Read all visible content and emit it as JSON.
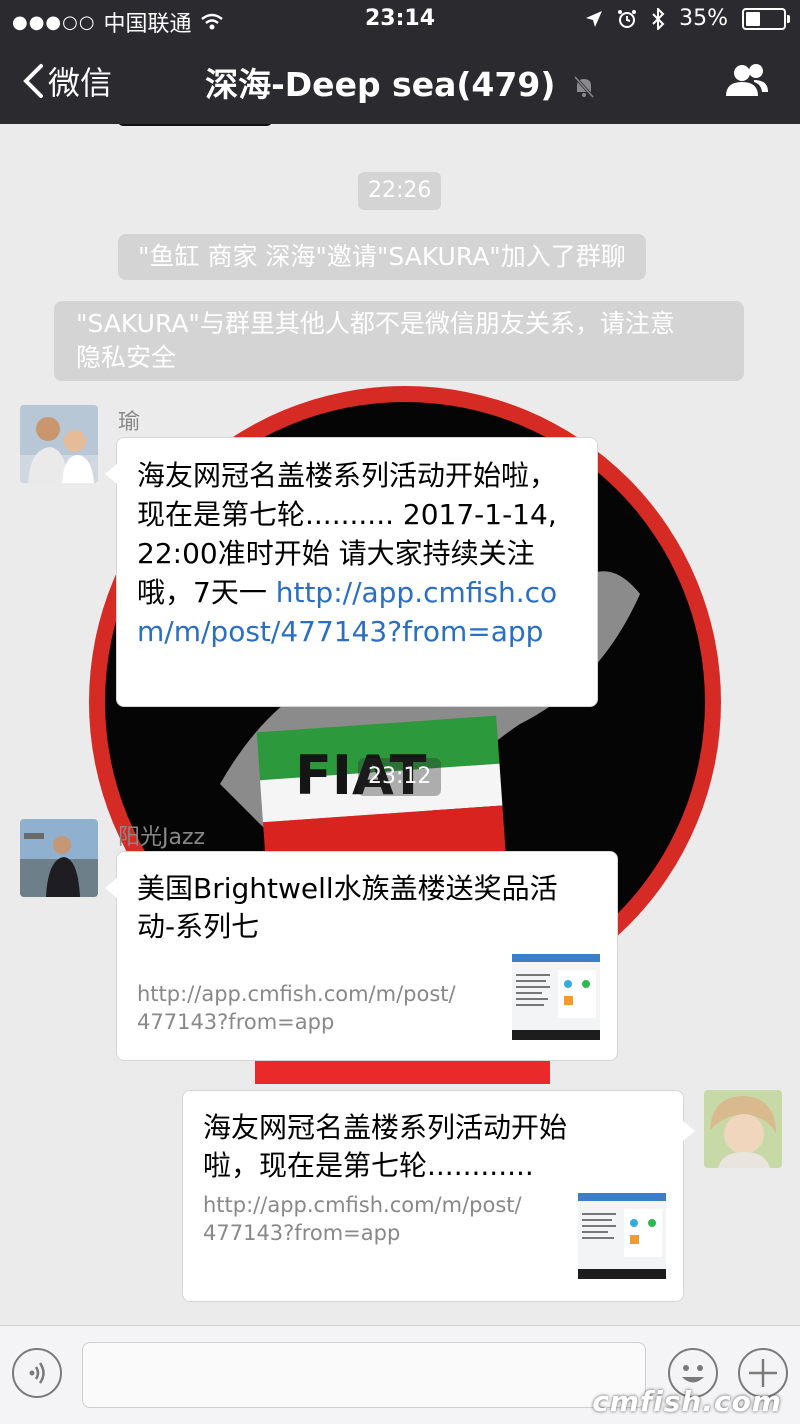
{
  "status_bar": {
    "signal": "●●●○○",
    "carrier": "中国联通",
    "time": "23:14",
    "battery": "35%",
    "battery_level": 0.35
  },
  "nav": {
    "back_label": "微信",
    "title": "深海-Deep sea(479)"
  },
  "chat": {
    "time_chip_1": "22:26",
    "system_1": "\"鱼缸 商家 深海\"邀请\"SAKURA\"加入了群聊",
    "system_2_line1": "\"SAKURA\"与群里其他人都不是微信朋友关系，请注意",
    "system_2_line2": "隐私安全",
    "msg1": {
      "sender": "瑜",
      "text": "海友网冠名盖楼系列活动开始啦，现在是第七轮.......... 2017-1-14, 22:00准时开始 请大家持续关注哦，7天一 ",
      "link": "http://app.cmfish.com/m/post/477143?from=app"
    },
    "time_chip_2": "23:12",
    "msg2": {
      "sender": "阳光Jazz",
      "title_line1": "美国Brightwell水族盖楼送奖品活",
      "title_line2": "动-系列七",
      "url_line1": "http://app.cmfish.com/m/post/",
      "url_line2": "477143?from=app"
    },
    "msg3": {
      "title_line1": "海友网冠名盖楼系列活动开始",
      "title_line2": "啦，现在是第七轮............",
      "url_line1": "http://app.cmfish.com/m/post/",
      "url_line2": "477143?from=app"
    },
    "wallpaper_text": "FIAT"
  },
  "watermark": "cmfish.com",
  "colors": {
    "nav_bg": "#2b2b2f",
    "chat_bg": "#ebebeb",
    "link": "#2a6fc4"
  }
}
